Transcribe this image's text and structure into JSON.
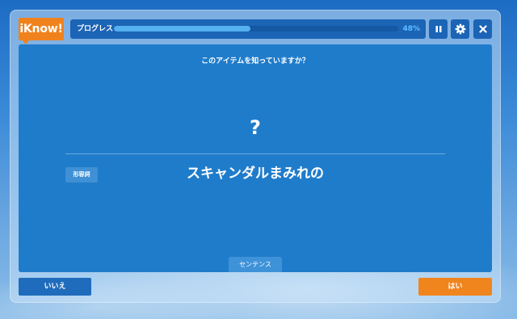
{
  "app": {
    "logo_text": "iKnow!"
  },
  "progress": {
    "label": "プログレス",
    "percent_text": "48%",
    "value": 0.48
  },
  "controls": {
    "pause_icon": "pause-icon",
    "settings_icon": "gear-icon",
    "close_icon": "close-icon"
  },
  "card": {
    "question": "このアイテムを知っていますか？",
    "hidden_answer": "?",
    "part_of_speech": "形容詞",
    "word": "スキャンダルまみれの",
    "sentence_tab": "センテンス"
  },
  "actions": {
    "no_label": "いいえ",
    "yes_label": "はい"
  },
  "colors": {
    "accent_orange": "#f0821e",
    "card_blue": "#1f7ccb",
    "dark_blue": "#1b64b6",
    "progress_fill": "#55b0f0"
  }
}
